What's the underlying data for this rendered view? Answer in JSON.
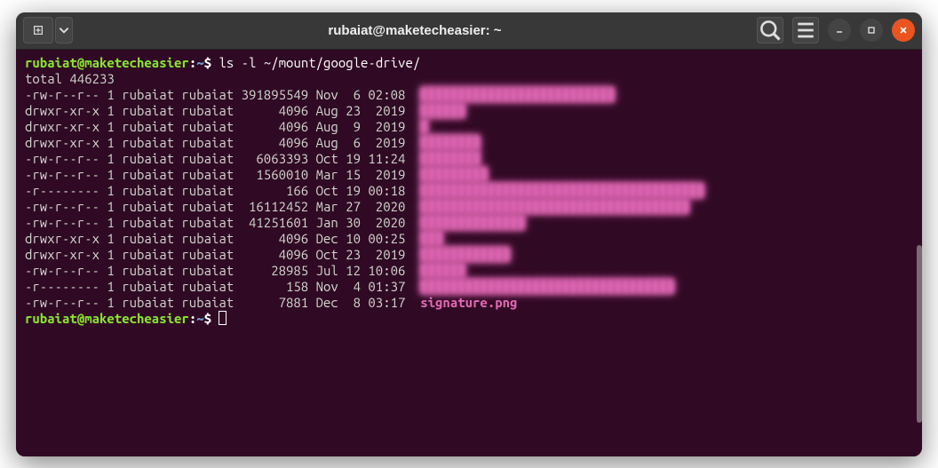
{
  "titlebar": {
    "title": "rubaiat@maketecheasier: ~"
  },
  "prompt": {
    "user_host": "rubaiat@maketecheasier",
    "separator": ":",
    "path": "~",
    "dollar": "$"
  },
  "command": "ls -l ~/mount/google-drive/",
  "total_line": "total 446233",
  "listing": [
    {
      "perms": "-rw-r--r--",
      "links": "1",
      "owner": "rubaiat",
      "group": "rubaiat",
      "size": "391895549",
      "month": "Nov",
      "day": " 6",
      "time": "02:08",
      "name": "██████████████████████████",
      "blurred": true,
      "is_dir": false
    },
    {
      "perms": "drwxr-xr-x",
      "links": "1",
      "owner": "rubaiat",
      "group": "rubaiat",
      "size": "4096",
      "month": "Aug",
      "day": "23",
      "time": " 2019",
      "name": "██████",
      "blurred": true,
      "is_dir": true
    },
    {
      "perms": "drwxr-xr-x",
      "links": "1",
      "owner": "rubaiat",
      "group": "rubaiat",
      "size": "4096",
      "month": "Aug",
      "day": " 9",
      "time": " 2019",
      "name": "█",
      "blurred": true,
      "is_dir": true
    },
    {
      "perms": "drwxr-xr-x",
      "links": "1",
      "owner": "rubaiat",
      "group": "rubaiat",
      "size": "4096",
      "month": "Aug",
      "day": " 6",
      "time": " 2019",
      "name": "████████",
      "blurred": true,
      "is_dir": true
    },
    {
      "perms": "-rw-r--r--",
      "links": "1",
      "owner": "rubaiat",
      "group": "rubaiat",
      "size": "6063393",
      "month": "Oct",
      "day": "19",
      "time": "11:24",
      "name": "████████",
      "blurred": true,
      "is_dir": false
    },
    {
      "perms": "-rw-r--r--",
      "links": "1",
      "owner": "rubaiat",
      "group": "rubaiat",
      "size": "1560010",
      "month": "Mar",
      "day": "15",
      "time": " 2019",
      "name": "█████████",
      "blurred": true,
      "is_dir": false
    },
    {
      "perms": "-r--------",
      "links": "1",
      "owner": "rubaiat",
      "group": "rubaiat",
      "size": "166",
      "month": "Oct",
      "day": "19",
      "time": "00:18",
      "name": "██████████████████████████████████████",
      "blurred": true,
      "is_dir": false
    },
    {
      "perms": "-rw-r--r--",
      "links": "1",
      "owner": "rubaiat",
      "group": "rubaiat",
      "size": "16112452",
      "month": "Mar",
      "day": "27",
      "time": " 2020",
      "name": "████████████████████████████████████",
      "blurred": true,
      "is_dir": false
    },
    {
      "perms": "-rw-r--r--",
      "links": "1",
      "owner": "rubaiat",
      "group": "rubaiat",
      "size": "41251601",
      "month": "Jan",
      "day": "30",
      "time": " 2020",
      "name": "██████████████",
      "blurred": true,
      "is_dir": false
    },
    {
      "perms": "drwxr-xr-x",
      "links": "1",
      "owner": "rubaiat",
      "group": "rubaiat",
      "size": "4096",
      "month": "Dec",
      "day": "10",
      "time": "00:25",
      "name": "███",
      "blurred": true,
      "is_dir": true
    },
    {
      "perms": "drwxr-xr-x",
      "links": "1",
      "owner": "rubaiat",
      "group": "rubaiat",
      "size": "4096",
      "month": "Oct",
      "day": "23",
      "time": " 2019",
      "name": "████████████",
      "blurred": true,
      "is_dir": true
    },
    {
      "perms": "-rw-r--r--",
      "links": "1",
      "owner": "rubaiat",
      "group": "rubaiat",
      "size": "28985",
      "month": "Jul",
      "day": "12",
      "time": "10:06",
      "name": "██████",
      "blurred": true,
      "is_dir": false
    },
    {
      "perms": "-r--------",
      "links": "1",
      "owner": "rubaiat",
      "group": "rubaiat",
      "size": "158",
      "month": "Nov",
      "day": " 4",
      "time": "01:37",
      "name": "██████████████████████████████████",
      "blurred": true,
      "is_dir": false
    },
    {
      "perms": "-rw-r--r--",
      "links": "1",
      "owner": "rubaiat",
      "group": "rubaiat",
      "size": "7881",
      "month": "Dec",
      "day": " 8",
      "time": "03:17",
      "name": "signature.png",
      "blurred": false,
      "is_dir": false
    }
  ]
}
